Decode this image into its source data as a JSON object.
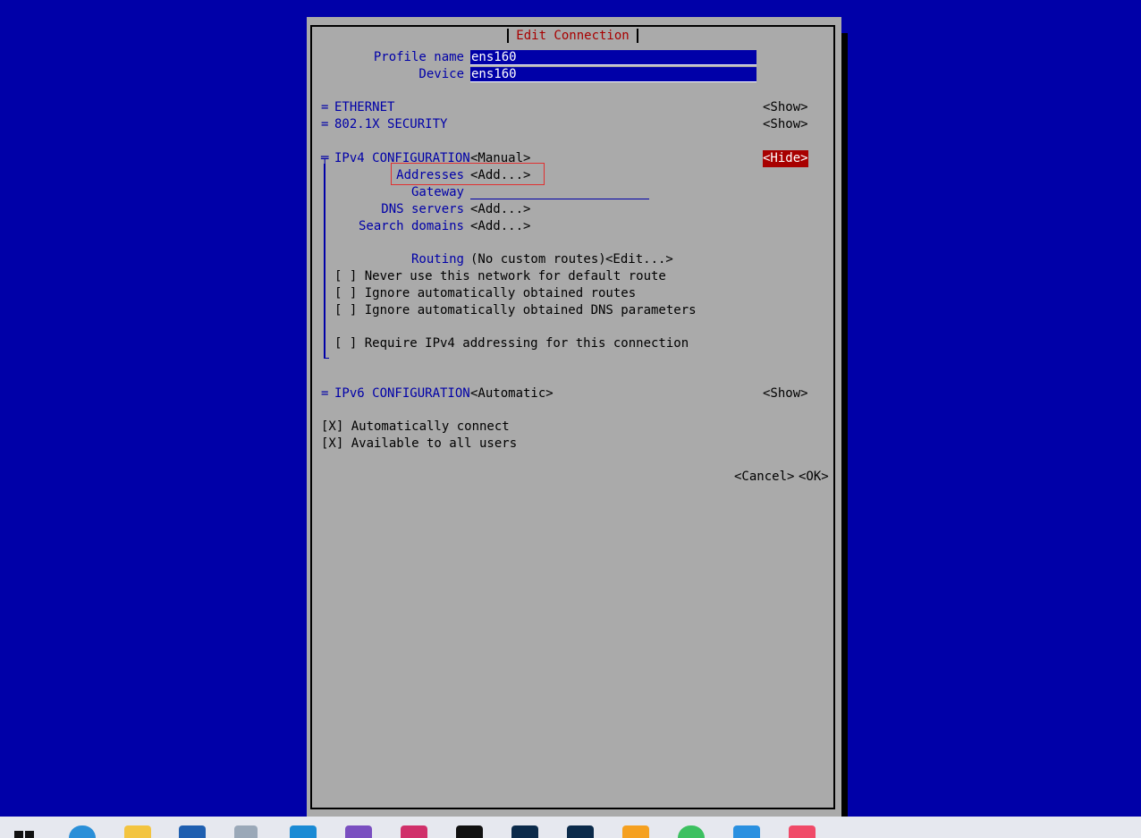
{
  "dialog": {
    "title": "Edit Connection",
    "profile_name_label": "Profile name",
    "profile_name_value": "ens160",
    "device_label": "Device",
    "device_value": "ens160",
    "ethernet": {
      "marker": "=",
      "label": "ETHERNET",
      "button": "<Show>"
    },
    "security": {
      "marker": "=",
      "label": "802.1X SECURITY",
      "button": "<Show>"
    },
    "ipv4": {
      "marker": "╤",
      "label": "IPv4 CONFIGURATION",
      "mode": "<Manual>",
      "hide_button": "<Hide>",
      "addresses_label": "Addresses",
      "addresses_button": "<Add...>",
      "gateway_label": "Gateway",
      "gateway_value": "",
      "dns_label": "DNS servers",
      "dns_button": "<Add...>",
      "search_label": "Search domains",
      "search_button": "<Add...>",
      "routing_label": "Routing",
      "routing_value": "(No custom routes)",
      "routing_button": "<Edit...>",
      "opt_never_default": "[ ] Never use this network for default route",
      "opt_ignore_routes": "[ ] Ignore automatically obtained routes",
      "opt_ignore_dns": "[ ] Ignore automatically obtained DNS parameters",
      "opt_require_ipv4": "[ ] Require IPv4 addressing for this connection"
    },
    "ipv6": {
      "marker": "=",
      "label": "IPv6 CONFIGURATION",
      "mode": "<Automatic>",
      "button": "<Show>"
    },
    "auto_connect": "[X] Automatically connect",
    "all_users": "[X] Available to all users",
    "cancel_button": "<Cancel>",
    "ok_button": "<OK>"
  },
  "taskbar": {
    "icons": [
      "windows-start-icon",
      "edge-browser-icon",
      "file-explorer-icon",
      "store-icon",
      "app-icon",
      "vscode-icon",
      "visual-studio-icon",
      "intellij-icon",
      "terminal-icon",
      "photoshop-icon",
      "lightroom-icon",
      "app-orange-icon",
      "wechat-icon",
      "app-blue-icon",
      "music-icon"
    ]
  },
  "colors": {
    "desktop_bg": "#0000a8",
    "dialog_bg": "#aaaaaa",
    "label_blue": "#0000a8",
    "title_red": "#a80000",
    "highlight_box": "#e03030"
  }
}
